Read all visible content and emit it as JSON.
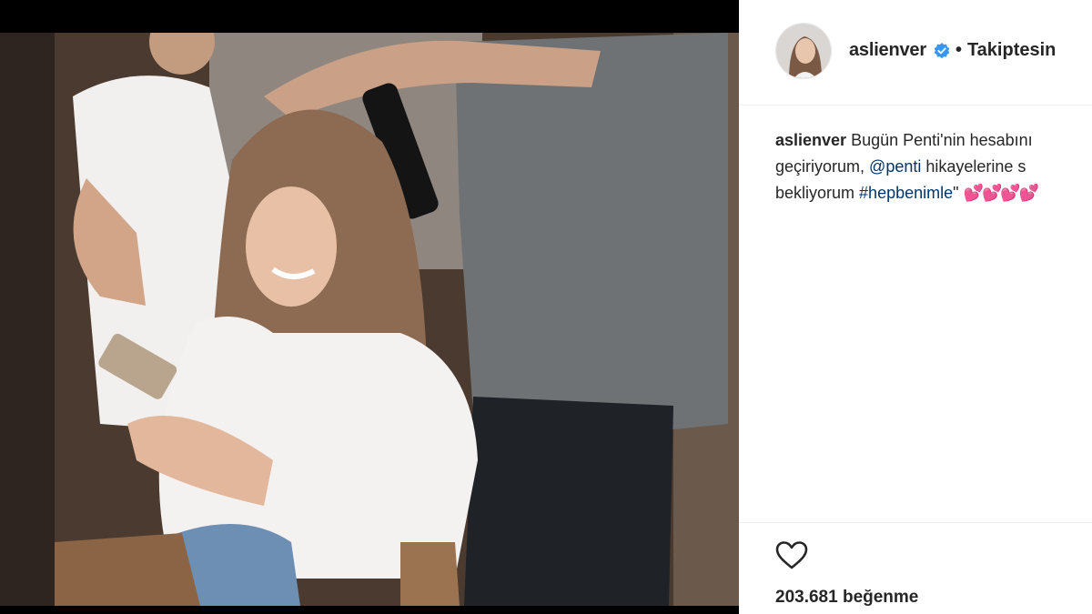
{
  "post": {
    "username": "aslienver",
    "verified": true,
    "separator": "•",
    "follow_status": "Takiptesin",
    "caption": {
      "user": "aslienver",
      "line1": "Bugün Penti'nin hesabını",
      "line2_a": "geçiriyorum,",
      "mention": "@penti",
      "line2_b": "hikayelerine s",
      "line3_a": "bekliyorum",
      "hashtag": "#hepbenimle",
      "line3_b": "\"",
      "hearts": "💕💕💕💕"
    },
    "likes_text": "203.681 beğenme"
  },
  "icons": {
    "verified": "verified-badge-icon",
    "like": "heart-outline-icon"
  },
  "colors": {
    "verified_blue": "#3897f0",
    "link_blue": "#003569",
    "text": "#262626",
    "divider": "#efefef",
    "heart_red": "#c1272d"
  }
}
